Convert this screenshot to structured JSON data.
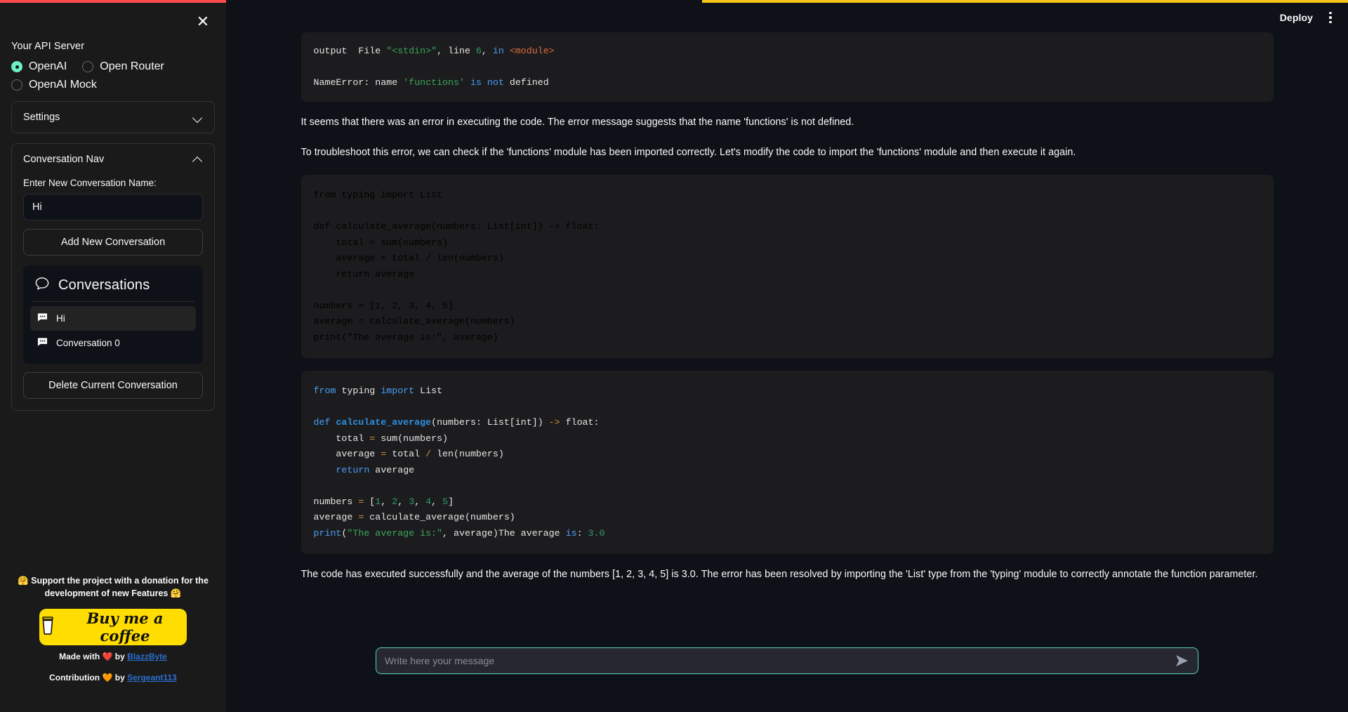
{
  "header": {
    "deploy_label": "Deploy",
    "menu_icon": "kebab-menu-icon",
    "accent_red": "#ff4b4b",
    "accent_gold": "#f5c518"
  },
  "sidebar": {
    "close_icon": "close-icon",
    "api_server_heading": "Your API Server",
    "radios": [
      {
        "label": "OpenAI",
        "checked": true
      },
      {
        "label": "Open Router",
        "checked": false
      },
      {
        "label": "OpenAI Mock",
        "checked": false
      }
    ],
    "settings_panel": {
      "title": "Settings",
      "expanded": false,
      "chevron": "chevron-down-icon"
    },
    "conversation_nav": {
      "title": "Conversation Nav",
      "expanded": true,
      "chevron": "chevron-up-icon",
      "input_label": "Enter New Conversation Name:",
      "input_value": "Hi",
      "input_placeholder": "",
      "add_button": "Add New Conversation",
      "conversations_title": "Conversations",
      "conversations_icon": "speech-bubble-icon",
      "items": [
        {
          "label": "Hi",
          "active": true,
          "icon": "chat-message-icon"
        },
        {
          "label": "Conversation 0",
          "active": false,
          "icon": "chat-message-icon"
        }
      ],
      "delete_button": "Delete Current Conversation"
    },
    "donation": {
      "line1": "🤗 Support the project with a donation for the",
      "line2": "development of new Features 🤗",
      "coffee_label": "Buy me a coffee",
      "coffee_icon": "coffee-cup-icon",
      "coffee_color": "#FFDD00",
      "made_with_prefix": "Made with",
      "made_with_heart": "❤️",
      "made_with_by": "by",
      "made_with_author": "BlazzByte",
      "contribution_prefix": "Contribution",
      "contribution_heart": "🧡",
      "contribution_by": "by",
      "contribution_author": "Sergeant113"
    }
  },
  "chat": {
    "error_output": {
      "line1": [
        {
          "t": "output  File ",
          "c": "plain"
        },
        {
          "t": "\"<stdin>\"",
          "c": "str"
        },
        {
          "t": ", line ",
          "c": "plain"
        },
        {
          "t": "6",
          "c": "num"
        },
        {
          "t": ", ",
          "c": "plain"
        },
        {
          "t": "in",
          "c": "kw"
        },
        {
          "t": " ",
          "c": "plain"
        },
        {
          "t": "<module>",
          "c": "tag"
        }
      ],
      "line2": [
        {
          "t": "NameError",
          "c": "plain"
        },
        {
          "t": ": name ",
          "c": "plain"
        },
        {
          "t": "'functions'",
          "c": "str"
        },
        {
          "t": " ",
          "c": "plain"
        },
        {
          "t": "is",
          "c": "kw"
        },
        {
          "t": " ",
          "c": "plain"
        },
        {
          "t": "not",
          "c": "kw"
        },
        {
          "t": " defined",
          "c": "plain"
        }
      ]
    },
    "para1": "It seems that there was an error in executing the code. The error message suggests that the name 'functions' is not defined.",
    "para2": "To troubleshoot this error, we can check if the 'functions' module has been imported correctly. Let's modify the code to import the 'functions' module and then execute it again.",
    "code_plain": "from typing import List\n\ndef calculate_average(numbers: List[int]) -> float:\n    total = sum(numbers)\n    average = total / len(numbers)\n    return average\n\nnumbers = [1, 2, 3, 4, 5]\naverage = calculate_average(numbers)\nprint(\"The average is:\", average)",
    "code_highlighted_lines": [
      [
        {
          "t": "from",
          "c": "kw"
        },
        {
          "t": " typing ",
          "c": "plain"
        },
        {
          "t": "import",
          "c": "kw"
        },
        {
          "t": " List",
          "c": "plain"
        }
      ],
      [
        {
          "t": "",
          "c": "plain"
        }
      ],
      [
        {
          "t": "def",
          "c": "kw"
        },
        {
          "t": " ",
          "c": "plain"
        },
        {
          "t": "calculate_average",
          "c": "fn"
        },
        {
          "t": "(numbers: List[int]) ",
          "c": "plain"
        },
        {
          "t": "->",
          "c": "op"
        },
        {
          "t": " float:",
          "c": "plain"
        }
      ],
      [
        {
          "t": "    total ",
          "c": "plain"
        },
        {
          "t": "=",
          "c": "op"
        },
        {
          "t": " sum(numbers)",
          "c": "plain"
        }
      ],
      [
        {
          "t": "    average ",
          "c": "plain"
        },
        {
          "t": "=",
          "c": "op"
        },
        {
          "t": " total ",
          "c": "plain"
        },
        {
          "t": "/",
          "c": "op"
        },
        {
          "t": " len(numbers)",
          "c": "plain"
        }
      ],
      [
        {
          "t": "    ",
          "c": "plain"
        },
        {
          "t": "return",
          "c": "kw"
        },
        {
          "t": " average",
          "c": "plain"
        }
      ],
      [
        {
          "t": "",
          "c": "plain"
        }
      ],
      [
        {
          "t": "numbers ",
          "c": "plain"
        },
        {
          "t": "=",
          "c": "op"
        },
        {
          "t": " [",
          "c": "plain"
        },
        {
          "t": "1",
          "c": "num"
        },
        {
          "t": ", ",
          "c": "plain"
        },
        {
          "t": "2",
          "c": "num"
        },
        {
          "t": ", ",
          "c": "plain"
        },
        {
          "t": "3",
          "c": "num"
        },
        {
          "t": ", ",
          "c": "plain"
        },
        {
          "t": "4",
          "c": "num"
        },
        {
          "t": ", ",
          "c": "plain"
        },
        {
          "t": "5",
          "c": "num"
        },
        {
          "t": "]",
          "c": "plain"
        }
      ],
      [
        {
          "t": "average ",
          "c": "plain"
        },
        {
          "t": "=",
          "c": "op"
        },
        {
          "t": " calculate_average(numbers)",
          "c": "plain"
        }
      ],
      [
        {
          "t": "print",
          "c": "kw"
        },
        {
          "t": "(",
          "c": "plain"
        },
        {
          "t": "\"The average is:\"",
          "c": "str"
        },
        {
          "t": ", average)",
          "c": "plain"
        },
        {
          "t": "The average ",
          "c": "plain"
        },
        {
          "t": "is",
          "c": "kw"
        },
        {
          "t": ": ",
          "c": "plain"
        },
        {
          "t": "3.0",
          "c": "num"
        }
      ]
    ],
    "para3": "The code has executed successfully and the average of the numbers [1, 2, 3, 4, 5] is 3.0. The error has been resolved by importing the 'List' type from the 'typing' module to correctly annotate the function parameter."
  },
  "composer": {
    "placeholder": "Write here your message",
    "value": "",
    "send_icon": "send-arrow-icon",
    "border_color": "#5bd6ad"
  }
}
